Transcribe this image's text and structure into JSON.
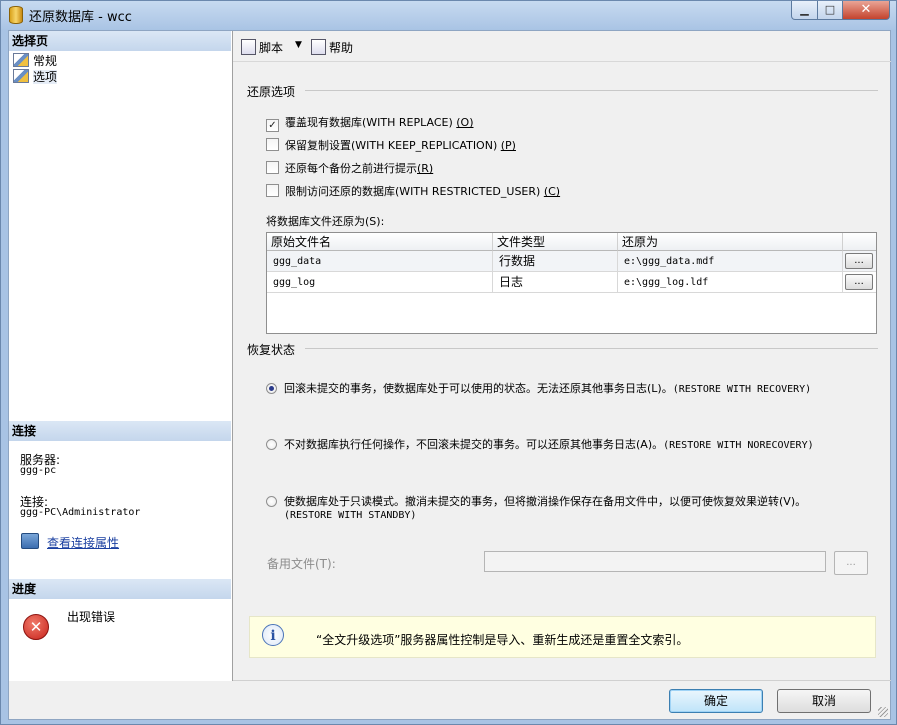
{
  "window": {
    "title": "还原数据库 - wcc",
    "min_glyph": "▁",
    "max_glyph": "□",
    "close_glyph": "✕"
  },
  "left_pane": {
    "pages_header": "选择页",
    "pages": [
      {
        "label": "常规"
      },
      {
        "label": "选项"
      }
    ],
    "connection_header": "连接",
    "server_label": "服务器:",
    "server_value": "ggg-pc",
    "connection_label": "连接:",
    "connection_value": "ggg-PC\\Administrator",
    "view_connection_link": "查看连接属性",
    "progress_header": "进度",
    "progress_status": "出现错误"
  },
  "toolbar": {
    "script_label": "脚本",
    "script_arrow": "▼",
    "help_label": "帮助"
  },
  "restore_options": {
    "group_title": "还原选项",
    "checkboxes": [
      {
        "text": "覆盖现有数据库(WITH REPLACE)",
        "key": "(O)",
        "checked": true
      },
      {
        "text": "保留复制设置(WITH KEEP_REPLICATION)",
        "key": "(P)",
        "checked": false
      },
      {
        "text": "还原每个备份之前进行提示",
        "key": "(R)",
        "checked": false
      },
      {
        "text": "限制访问还原的数据库(WITH RESTRICTED_USER)",
        "key": "(C)",
        "checked": false
      }
    ],
    "check_glyph": "✓",
    "files_label": "将数据库文件还原为(S):",
    "grid_headers": [
      "原始文件名",
      "文件类型",
      "还原为"
    ],
    "grid_rows": [
      {
        "original": "ggg_data",
        "type": "行数据",
        "restore_as": "e:\\ggg_data.mdf",
        "button": "..."
      },
      {
        "original": "ggg_log",
        "type": "日志",
        "restore_as": "e:\\ggg_log.ldf",
        "button": "..."
      }
    ]
  },
  "recovery_state": {
    "group_title": "恢复状态",
    "options": [
      {
        "text": "回滚未提交的事务，使数据库处于可以使用的状态。无法还原其他事务日志(L)。",
        "sql": "(RESTORE WITH RECOVERY)",
        "selected": true
      },
      {
        "text": "不对数据库执行任何操作，不回滚未提交的事务。可以还原其他事务日志(A)。",
        "sql": "(RESTORE WITH NORECOVERY)",
        "selected": false
      },
      {
        "text": "使数据库处于只读模式。撤消未提交的事务，但将撤消操作保存在备用文件中，以便可使恢复效果逆转(V)。",
        "sql": "(RESTORE WITH STANDBY)",
        "selected": false
      }
    ],
    "standby_file_label": "备用文件(T):",
    "standby_file_value": "",
    "standby_browse": "..."
  },
  "info": {
    "icon": "i",
    "text": "“全文升级选项”服务器属性控制是导入、重新生成还是重置全文索引。"
  },
  "buttons": {
    "ok": "确定",
    "cancel": "取消"
  },
  "error_icon": "✕"
}
